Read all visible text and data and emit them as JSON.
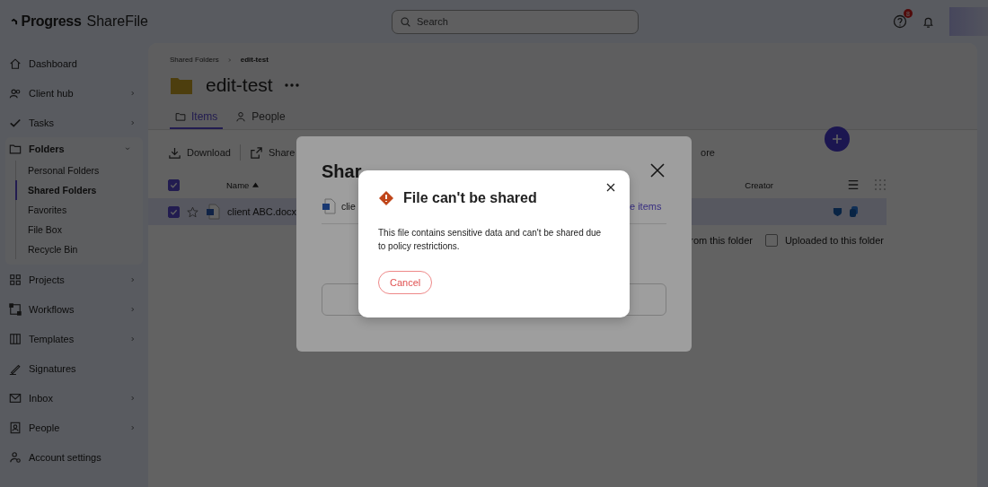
{
  "logo": {
    "brand": "Progress",
    "product": "ShareFile"
  },
  "header": {
    "search_placeholder": "Search",
    "help_badge": "8"
  },
  "sidebar": {
    "items": [
      {
        "label": "Dashboard",
        "submenu": false
      },
      {
        "label": "Client hub",
        "submenu": true
      },
      {
        "label": "Tasks",
        "submenu": true
      },
      {
        "label": "Folders",
        "submenu": true,
        "expanded": true,
        "children": [
          {
            "label": "Personal Folders",
            "selected": false
          },
          {
            "label": "Shared Folders",
            "selected": true
          },
          {
            "label": "Favorites",
            "selected": false
          },
          {
            "label": "File Box",
            "selected": false
          },
          {
            "label": "Recycle Bin",
            "selected": false
          }
        ]
      },
      {
        "label": "Projects",
        "submenu": true
      },
      {
        "label": "Workflows",
        "submenu": true
      },
      {
        "label": "Templates",
        "submenu": true
      },
      {
        "label": "Signatures",
        "submenu": false
      },
      {
        "label": "Inbox",
        "submenu": true
      },
      {
        "label": "People",
        "submenu": true
      },
      {
        "label": "Account settings",
        "submenu": false
      }
    ]
  },
  "breadcrumb": [
    "Shared Folders",
    "edit-test"
  ],
  "folder_title": "edit-test",
  "tabs": [
    {
      "label": "Items",
      "selected": true
    },
    {
      "label": "People",
      "selected": false
    }
  ],
  "toolbar": [
    "Download",
    "Share",
    "ore"
  ],
  "table": {
    "select_all": true,
    "columns": [
      "Name",
      "Creator"
    ],
    "rows": [
      {
        "name": "client ABC.docx",
        "checked": true,
        "starred": false
      }
    ]
  },
  "filters": {
    "partial_label": "rom this folder",
    "options": [
      {
        "label": "Uploaded to this folder",
        "checked": false
      }
    ]
  },
  "share_dialog": {
    "title": "Shar",
    "file": "clie",
    "link": "e items"
  },
  "alert": {
    "title": "File can't be shared",
    "message": "This file contains sensitive data and can't be shared due to policy restrictions.",
    "buttons": [
      {
        "label": "Cancel"
      }
    ]
  }
}
